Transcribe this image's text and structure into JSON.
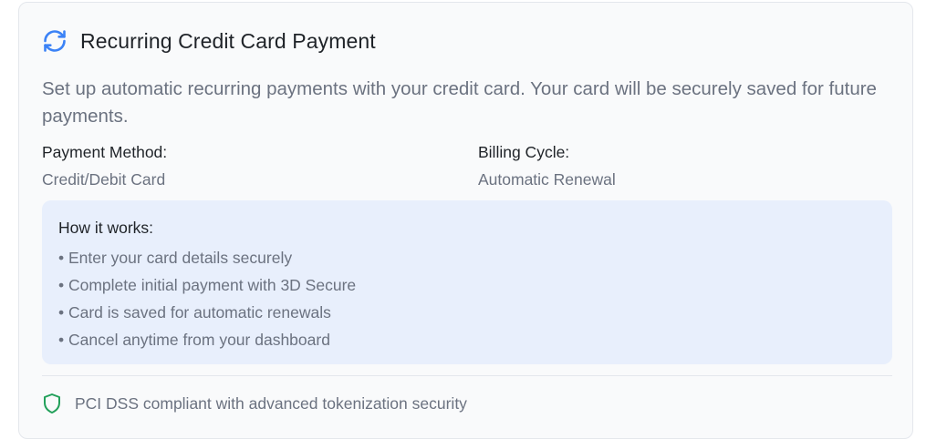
{
  "header": {
    "icon": "refresh-icon",
    "title": "Recurring Credit Card Payment"
  },
  "description": "Set up automatic recurring payments with your credit card. Your card will be securely saved for future payments.",
  "details": {
    "payment_method_label": "Payment Method:",
    "payment_method_value": "Credit/Debit Card",
    "billing_cycle_label": "Billing Cycle:",
    "billing_cycle_value": "Automatic Renewal"
  },
  "how_it_works": {
    "title": "How it works:",
    "items": [
      "• Enter your card details securely",
      "• Complete initial payment with 3D Secure",
      "• Card is saved for automatic renewals",
      "• Cancel anytime from your dashboard"
    ]
  },
  "security": {
    "icon": "shield-icon",
    "text": "PCI DSS compliant with advanced tokenization security"
  },
  "colors": {
    "accent": "#3b82f6",
    "success": "#22a05a",
    "info_bg": "#e8effc"
  }
}
